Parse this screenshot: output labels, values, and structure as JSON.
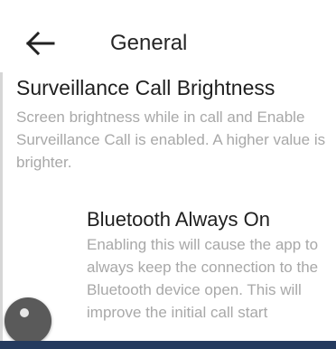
{
  "app_bar": {
    "back_icon": "arrow-left-icon",
    "title": "General"
  },
  "brightness_section": {
    "title": "Surveillance Call Brightness",
    "description": "Screen brightness while in call and Enable Surveillance Call is enabled. A higher value is brighter."
  },
  "bluetooth_setting": {
    "title": "Bluetooth Always On",
    "description": "Enabling this will cause the app to always keep the connection to the Bluetooth device open. This will improve the initial call start",
    "toggle_icon": "toggle-switch-icon",
    "enabled": false
  },
  "colors": {
    "title_text": "#262626",
    "description_text": "#a8a8a8",
    "bottom_bar": "#243a5e"
  }
}
